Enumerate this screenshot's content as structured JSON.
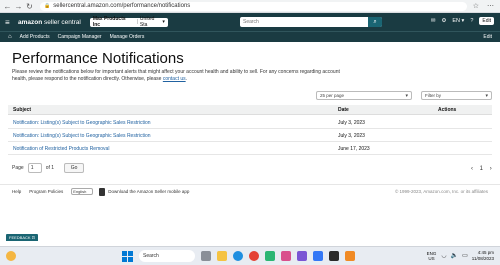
{
  "browser": {
    "url": "sellercentral.amazon.com/performance/notifications",
    "back": "←",
    "forward": "→",
    "reload": "↻",
    "lock": "🔒",
    "actions": "☆ ⋯"
  },
  "header": {
    "menu": "≡",
    "logo_bold": "amazon",
    "logo_rest": " seller central",
    "account_name": "Max Products Inc",
    "account_sep": "|",
    "account_region": "United Sta",
    "account_caret": "▾",
    "search_placeholder": "Search",
    "search_icon": "⌕",
    "mail_icon": "✉",
    "settings_icon": "⚙",
    "language": "EN ▾",
    "help_icon": "?",
    "edit": "Edit"
  },
  "nav": {
    "home_icon": "⌂",
    "items": [
      "Add Products",
      "Campaign Manager",
      "Manage Orders"
    ],
    "edit": "Edit"
  },
  "page": {
    "title": "Performance Notifications",
    "description": "Please review the notifications below for important alerts that might affect your account health and ability to sell. For any concerns regarding account health, please respond to the notification directly. Otherwise, please",
    "contact_link": "contact us",
    "description_end": "."
  },
  "filters": {
    "per_page": "25 per page",
    "filter_by": "Filter by",
    "caret": "▾"
  },
  "table": {
    "headers": {
      "subject": "Subject",
      "date": "Date",
      "actions": "Actions"
    },
    "rows": [
      {
        "subject": "Notification: Listing(s) Subject to Geographic Sales Restriction",
        "date": "July 3, 2023"
      },
      {
        "subject": "Notification: Listing(s) Subject to Geographic Sales Restriction",
        "date": "July 3, 2023"
      },
      {
        "subject": "Notification of Restricted Products Removal",
        "date": "June 17, 2023"
      }
    ]
  },
  "pagination": {
    "page_label": "Page",
    "page_value": "1",
    "of_label": "of 1",
    "go": "Go",
    "prev": "‹",
    "current": "1",
    "next": "›"
  },
  "footer": {
    "help": "Help",
    "program_policies": "Program Policies",
    "language": "English",
    "app_text": "Download the Amazon Seller mobile app",
    "copyright": "© 1999-2023, Amazon.com, Inc. or its affiliates"
  },
  "feedback": "FEEDBACK ⊡",
  "taskbar": {
    "search": "Search",
    "lang_line1": "ENG",
    "lang_line2": "US",
    "wifi": "◡",
    "volume": "🔈",
    "battery": "▭",
    "time": "4:45 pm",
    "date": "11/08/2023"
  }
}
